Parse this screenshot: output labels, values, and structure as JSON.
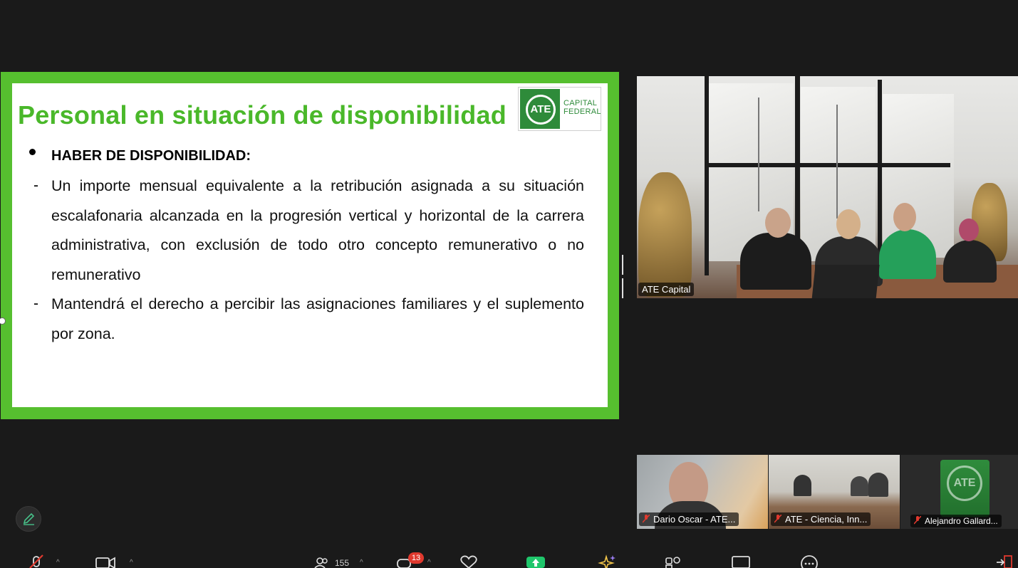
{
  "slide": {
    "title": "Personal en situación de disponibilidad",
    "logo": {
      "mark": "ATE",
      "line1": "CAPITAL",
      "line2": "FEDERAL"
    },
    "bullet_heading": "HABER DE DISPONIBILIDAD:",
    "dash": "-",
    "items": [
      "Un importe mensual equivalente a la retribución asignada a su situación escalafonaria alcanzada en la progresión vertical y horizontal de la carrera administrativa, con exclusión de todo otro concepto remunerativo o no remunerativo",
      "Mantendrá el derecho a percibir las asignaciones familiares y el suplemento por zona."
    ],
    "colors": {
      "border": "#56bf2f",
      "title": "#4ab82a",
      "logo": "#2e8b3a"
    }
  },
  "main_video": {
    "name": "ATE Capital"
  },
  "thumbnails": [
    {
      "name": "Dario Oscar - ATE...",
      "muted": true
    },
    {
      "name": "ATE - Ciencia, Inn...",
      "muted": true
    },
    {
      "name": "Alejandro Gallard...",
      "muted": true,
      "avatar": "ATE"
    }
  ],
  "toolbar": {
    "participants_count": "155",
    "chat_badge": "13",
    "icons": [
      "mic-muted-icon",
      "video-icon",
      "participants-icon",
      "chat-icon",
      "reactions-icon",
      "share-icon",
      "ai-companion-icon",
      "apps-icon",
      "whiteboard-icon",
      "more-icon",
      "leave-icon"
    ]
  },
  "annotate": {
    "icon": "pencil-icon"
  }
}
